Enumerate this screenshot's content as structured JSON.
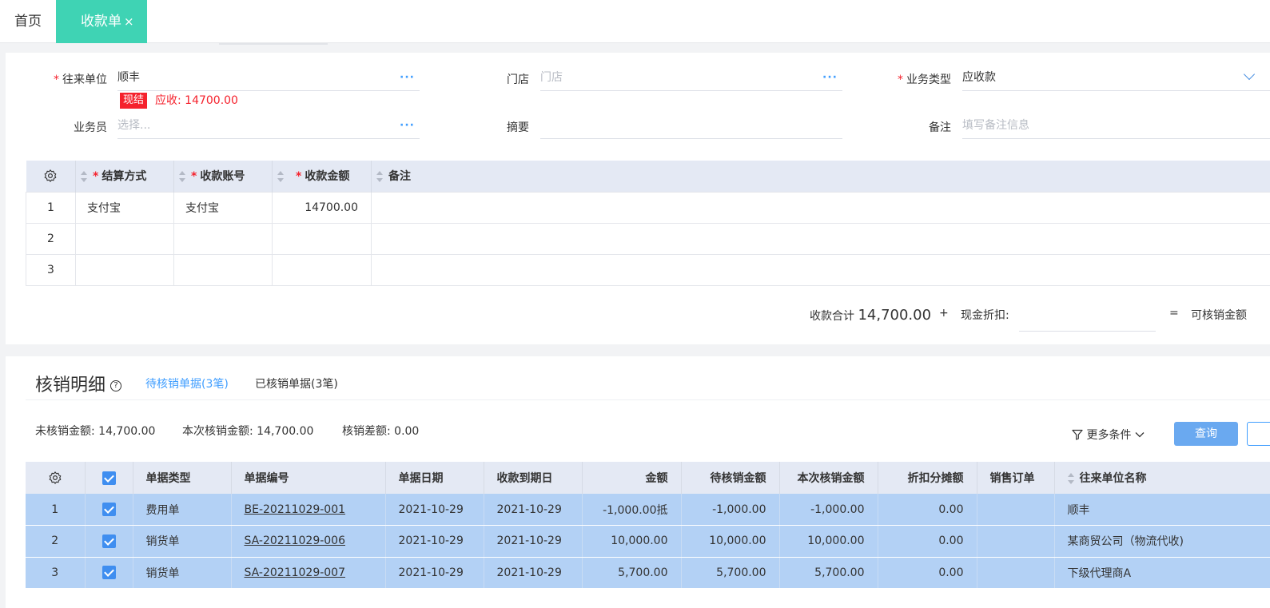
{
  "tabs": {
    "home": "首页",
    "active": "收款单",
    "close": "×"
  },
  "form": {
    "partner_label": "往来单位",
    "partner_value": "顺丰",
    "store_label": "门店",
    "store_placeholder": "门店",
    "biz_type_label": "业务类型",
    "biz_type_value": "应收款",
    "badge": "现结",
    "receivable": "应收: 14700.00",
    "salesman_label": "业务员",
    "salesman_placeholder": "选择...",
    "summary_label": "摘要",
    "remark_label": "备注",
    "remark_placeholder": "填写备注信息",
    "required_mark": "*",
    "more_dots": "···"
  },
  "payment_table": {
    "headers": [
      "结算方式",
      "收款账号",
      "收款金额",
      "备注"
    ],
    "rows": [
      {
        "idx": "1",
        "method": "支付宝",
        "account": "支付宝",
        "amount": "14700.00",
        "remark": ""
      },
      {
        "idx": "2",
        "method": "",
        "account": "",
        "amount": "",
        "remark": ""
      },
      {
        "idx": "3",
        "method": "",
        "account": "",
        "amount": "",
        "remark": ""
      }
    ]
  },
  "totals": {
    "receipt_total_label": "收款合计",
    "receipt_total_value": "14,700.00",
    "plus": "+",
    "cash_discount_label": "现金折扣:",
    "equals": "=",
    "writeoff_label": "可核销金额"
  },
  "writeoff": {
    "title": "核销明细",
    "help": "?",
    "tab_pending": "待核销单据(3笔)",
    "tab_done": "已核销单据(3笔)",
    "unwritten": "未核销金额: 14,700.00",
    "current": "本次核销金额: 14,700.00",
    "diff": "核销差额: 0.00",
    "more_conditions": "更多条件",
    "query": "查询",
    "headers": [
      "单据类型",
      "单据编号",
      "单据日期",
      "收款到期日",
      "金额",
      "待核销金额",
      "本次核销金额",
      "折扣分摊额",
      "销售订单",
      "往来单位名称"
    ],
    "rows": [
      {
        "idx": "1",
        "type": "费用单",
        "no": "BE-20211029-001",
        "date": "2021-10-29",
        "due": "2021-10-29",
        "amount": "-1,000.00抵",
        "pending": "-1,000.00",
        "current": "-1,000.00",
        "discount": "0.00",
        "order": "",
        "partner": "顺丰"
      },
      {
        "idx": "2",
        "type": "销货单",
        "no": "SA-20211029-006",
        "date": "2021-10-29",
        "due": "2021-10-29",
        "amount": "10,000.00",
        "pending": "10,000.00",
        "current": "10,000.00",
        "discount": "0.00",
        "order": "",
        "partner": "某商贸公司（物流代收)"
      },
      {
        "idx": "3",
        "type": "销货单",
        "no": "SA-20211029-007",
        "date": "2021-10-29",
        "due": "2021-10-29",
        "amount": "5,700.00",
        "pending": "5,700.00",
        "current": "5,700.00",
        "discount": "0.00",
        "order": "",
        "partner": "下级代理商A"
      }
    ]
  },
  "colors": {
    "tab_active": "#3fd3b4",
    "link_blue": "#409eff",
    "required_red": "#f5222d",
    "row_selected": "#b3d1f5",
    "header_bg": "#e4e9f4"
  }
}
